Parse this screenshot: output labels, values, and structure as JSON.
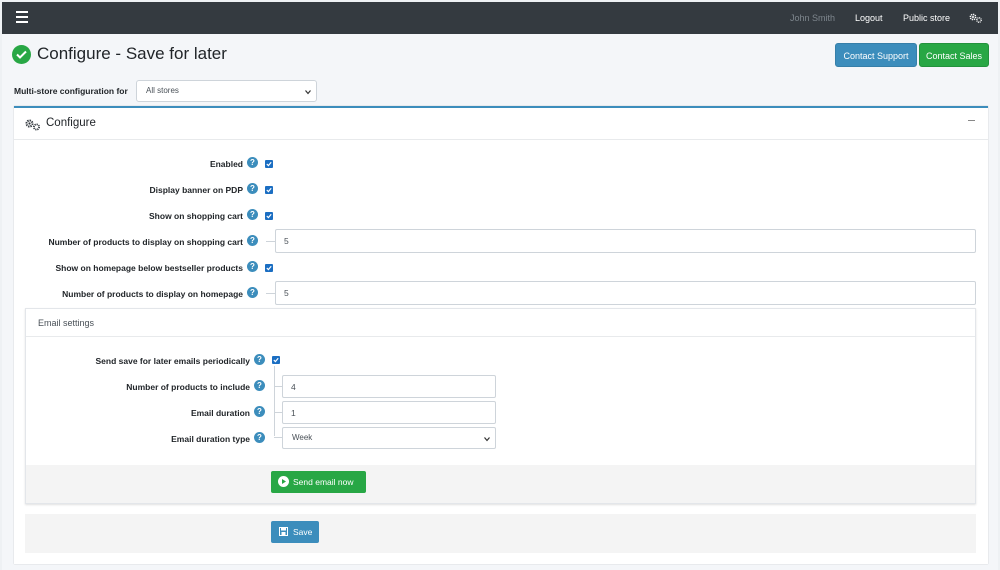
{
  "topbar": {
    "user_name": "John Smith",
    "logout_label": "Logout",
    "public_store_label": "Public store"
  },
  "page": {
    "title": "Configure - Save for later",
    "contact_support_label": "Contact Support",
    "contact_sales_label": "Contact Sales"
  },
  "store_config": {
    "label": "Multi-store configuration for",
    "selected": "All stores"
  },
  "configure_card": {
    "title": "Configure",
    "settings": [
      {
        "label": "Enabled",
        "type": "checkbox",
        "checked": true
      },
      {
        "label": "Display banner on PDP",
        "type": "checkbox",
        "checked": true
      },
      {
        "label": "Show on shopping cart",
        "type": "checkbox",
        "checked": true
      },
      {
        "label": "Number of products to display on shopping cart",
        "type": "text",
        "value": "5"
      },
      {
        "label": "Show on homepage below bestseller products",
        "type": "checkbox",
        "checked": true
      },
      {
        "label": "Number of products to display on homepage",
        "type": "text",
        "value": "5"
      }
    ]
  },
  "email_settings": {
    "title": "Email settings",
    "fields": [
      {
        "label": "Send save for later emails periodically",
        "type": "checkbox",
        "checked": true
      },
      {
        "label": "Number of products to include",
        "type": "text",
        "value": "4"
      },
      {
        "label": "Email duration",
        "type": "text",
        "value": "1"
      },
      {
        "label": "Email duration type",
        "type": "select",
        "value": "Week"
      }
    ],
    "send_button_label": "Send email now"
  },
  "save_button_label": "Save",
  "colors": {
    "topbar": "#343a40",
    "primary": "#3c8dbc",
    "success": "#28a745",
    "checkbox": "#1b6ec2"
  }
}
